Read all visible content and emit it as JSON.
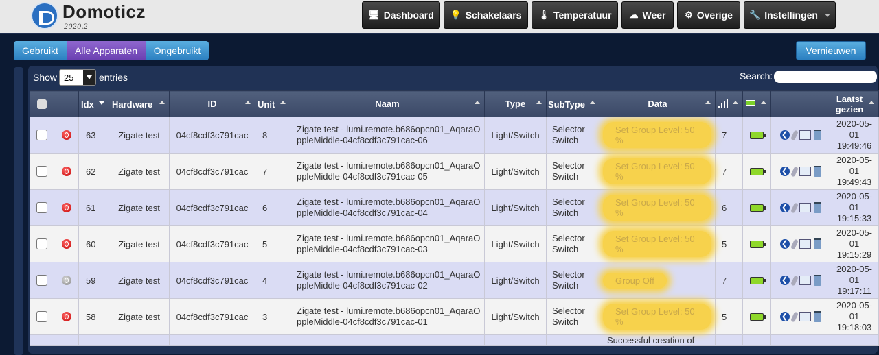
{
  "header": {
    "brand": "Domoticz",
    "version": "2020.2",
    "nav": [
      {
        "label": "Dashboard",
        "icon": "dashboard-icon"
      },
      {
        "label": "Schakelaars",
        "icon": "lightbulb-icon"
      },
      {
        "label": "Temperatuur",
        "icon": "thermometer-icon"
      },
      {
        "label": "Weer",
        "icon": "weather-icon"
      },
      {
        "label": "Overige",
        "icon": "utility-icon"
      },
      {
        "label": "Instellingen",
        "icon": "settings-icon"
      }
    ]
  },
  "toolbar": {
    "tabs": [
      "Gebruikt",
      "Alle Apparaten",
      "Ongebruikt"
    ],
    "active_tab": "Alle Apparaten",
    "refresh_label": "Vernieuwen"
  },
  "table_controls": {
    "show_label": "Show",
    "entries_value": "25",
    "entries_label": "entries",
    "search_label": "Search:",
    "search_value": ""
  },
  "columns": [
    "",
    "",
    "Idx",
    "Hardware",
    "ID",
    "Unit",
    "Naam",
    "Type",
    "SubType",
    "Data",
    "",
    "",
    "",
    "Laatst gezien"
  ],
  "column_icons": {
    "signal": "signal-icon",
    "battery": "battery-icon"
  },
  "rows": [
    {
      "status": "on",
      "idx": "63",
      "hardware": "Zigate test",
      "id": "04cf8cdf3c791cac",
      "unit": "8",
      "naam": "Zigate test - lumi.remote.b686opcn01_AqaraOppleMiddle-04cf8cdf3c791cac-06",
      "type": "Light/Switch",
      "subtype": "Selector Switch",
      "data": "Set Group Level: 50 %",
      "signal": "7",
      "last_seen": "2020-05-01 19:49:46"
    },
    {
      "status": "on",
      "idx": "62",
      "hardware": "Zigate test",
      "id": "04cf8cdf3c791cac",
      "unit": "7",
      "naam": "Zigate test - lumi.remote.b686opcn01_AqaraOppleMiddle-04cf8cdf3c791cac-05",
      "type": "Light/Switch",
      "subtype": "Selector Switch",
      "data": "Set Group Level: 50 %",
      "signal": "7",
      "last_seen": "2020-05-01 19:49:43"
    },
    {
      "status": "on",
      "idx": "61",
      "hardware": "Zigate test",
      "id": "04cf8cdf3c791cac",
      "unit": "6",
      "naam": "Zigate test - lumi.remote.b686opcn01_AqaraOppleMiddle-04cf8cdf3c791cac-04",
      "type": "Light/Switch",
      "subtype": "Selector Switch",
      "data": "Set Group Level: 50 %",
      "signal": "6",
      "last_seen": "2020-05-01 19:15:33"
    },
    {
      "status": "on",
      "idx": "60",
      "hardware": "Zigate test",
      "id": "04cf8cdf3c791cac",
      "unit": "5",
      "naam": "Zigate test - lumi.remote.b686opcn01_AqaraOppleMiddle-04cf8cdf3c791cac-03",
      "type": "Light/Switch",
      "subtype": "Selector Switch",
      "data": "Set Group Level: 50 %",
      "signal": "5",
      "last_seen": "2020-05-01 19:15:29"
    },
    {
      "status": "off",
      "idx": "59",
      "hardware": "Zigate test",
      "id": "04cf8cdf3c791cac",
      "unit": "4",
      "naam": "Zigate test - lumi.remote.b686opcn01_AqaraOppleMiddle-04cf8cdf3c791cac-02",
      "type": "Light/Switch",
      "subtype": "Selector Switch",
      "data": "Group Off",
      "signal": "7",
      "last_seen": "2020-05-01 19:17:11"
    },
    {
      "status": "on",
      "idx": "58",
      "hardware": "Zigate test",
      "id": "04cf8cdf3c791cac",
      "unit": "3",
      "naam": "Zigate test - lumi.remote.b686opcn01_AqaraOppleMiddle-04cf8cdf3c791cac-01",
      "type": "Light/Switch",
      "subtype": "Selector Switch",
      "data": "Set Group Level: 50 %",
      "signal": "5",
      "last_seen": "2020-05-01 19:18:03"
    }
  ],
  "partial_row": {
    "data": "Successful creation of"
  },
  "colors": {
    "header_bg": "#e8e8e8",
    "page_bg": "#0c1a33",
    "row_odd": "#dadcf4",
    "row_even": "#f3f3f3",
    "tab_active": "#7a4fb8",
    "tab": "#3d8fcc",
    "highlight": "#f7d24c"
  }
}
